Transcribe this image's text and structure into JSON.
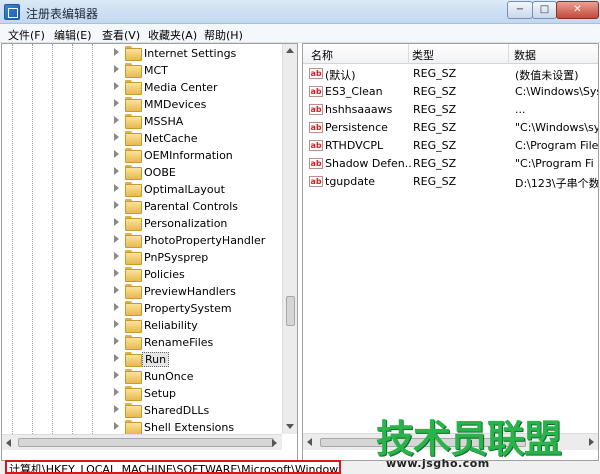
{
  "window": {
    "title": "注册表编辑器"
  },
  "controls": {
    "minimize": "−",
    "maximize": "□",
    "close": "✕"
  },
  "menu": [
    {
      "label": "文件(F)"
    },
    {
      "label": "编辑(E)"
    },
    {
      "label": "查看(V)"
    },
    {
      "label": "收藏夹(A)"
    },
    {
      "label": "帮助(H)"
    }
  ],
  "tree": {
    "items": [
      {
        "label": "Internet Settings"
      },
      {
        "label": "MCT"
      },
      {
        "label": "Media Center"
      },
      {
        "label": "MMDevices"
      },
      {
        "label": "MSSHA"
      },
      {
        "label": "NetCache"
      },
      {
        "label": "OEMInformation"
      },
      {
        "label": "OOBE"
      },
      {
        "label": "OptimalLayout"
      },
      {
        "label": "Parental Controls"
      },
      {
        "label": "Personalization"
      },
      {
        "label": "PhotoPropertyHandler"
      },
      {
        "label": "PnPSysprep"
      },
      {
        "label": "Policies"
      },
      {
        "label": "PreviewHandlers"
      },
      {
        "label": "PropertySystem"
      },
      {
        "label": "Reliability"
      },
      {
        "label": "RenameFiles"
      },
      {
        "label": "Run",
        "selected": true
      },
      {
        "label": "RunOnce"
      },
      {
        "label": "Setup"
      },
      {
        "label": "SharedDLLs"
      },
      {
        "label": "Shell Extensions"
      }
    ]
  },
  "list": {
    "columns": [
      "名称",
      "类型",
      "数据"
    ],
    "rows": [
      {
        "name": "(默认)",
        "type": "REG_SZ",
        "data": "(数值未设置)"
      },
      {
        "name": "ES3_Clean",
        "type": "REG_SZ",
        "data": "C:\\Windows\\Sys"
      },
      {
        "name": "hshhsaaaws",
        "type": "REG_SZ",
        "data": "..."
      },
      {
        "name": "Persistence",
        "type": "REG_SZ",
        "data": "\"C:\\Windows\\sy"
      },
      {
        "name": "RTHDVCPL",
        "type": "REG_SZ",
        "data": "C:\\Program File"
      },
      {
        "name": "Shadow Defen...",
        "type": "REG_SZ",
        "data": "\"C:\\Program Fi"
      },
      {
        "name": "tgupdate",
        "type": "REG_SZ",
        "data": "D:\\123\\子串个数"
      }
    ]
  },
  "status": {
    "path": "计算机\\HKEY_LOCAL_MACHINE\\SOFTWARE\\Microsoft\\Windows\\CurrentVersion\\Run"
  },
  "watermark": {
    "title": "技术员联盟",
    "url": "www.jsgho.com"
  },
  "colors": {
    "status_highlight": "#d9161a",
    "watermark_green": "#29b34a"
  }
}
